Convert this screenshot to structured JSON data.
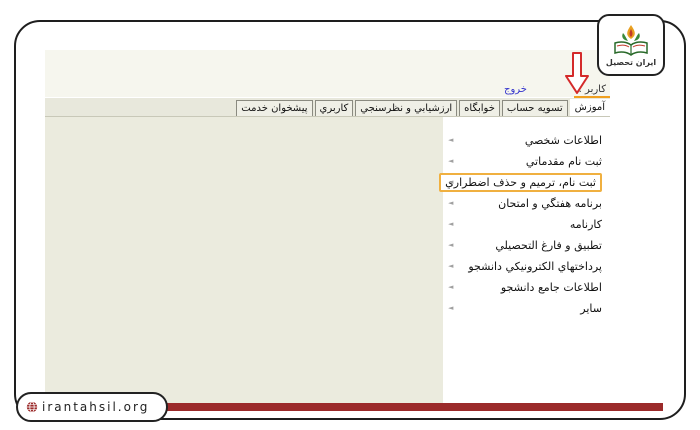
{
  "brand": {
    "logo_text": "ایران تحصیل",
    "site": "irantahsil.org"
  },
  "header": {
    "user_label": "کاربر :",
    "logout": "خروج"
  },
  "tabs": [
    {
      "label": "آموزش",
      "active": true
    },
    {
      "label": "تسویه حساب",
      "active": false
    },
    {
      "label": "خوابگاه",
      "active": false
    },
    {
      "label": "ارزشيابي و نظرسنجي",
      "active": false
    },
    {
      "label": "کاربري",
      "active": false
    },
    {
      "label": "پيشخوان خدمت",
      "active": false
    }
  ],
  "menu": [
    {
      "label": "اطلاعات شخصي",
      "highlight": false
    },
    {
      "label": "ثبت نام مقدماتي",
      "highlight": false
    },
    {
      "label": "ثبت نام، ترميم و حذف اضطراري",
      "highlight": true
    },
    {
      "label": "برنامه هفتگي و امتحان",
      "highlight": false
    },
    {
      "label": "کارنامه",
      "highlight": false
    },
    {
      "label": "تطبيق و فارغ التحصيلي",
      "highlight": false
    },
    {
      "label": "پرداختهاي الكترونيكي دانشجو",
      "highlight": false
    },
    {
      "label": "اطلاعات جامع دانشجو",
      "highlight": false
    },
    {
      "label": "ساير",
      "highlight": false
    }
  ],
  "colors": {
    "accent_red": "#9b2a2a",
    "highlight_orange": "#f0b040",
    "link_blue": "#3333cc"
  }
}
